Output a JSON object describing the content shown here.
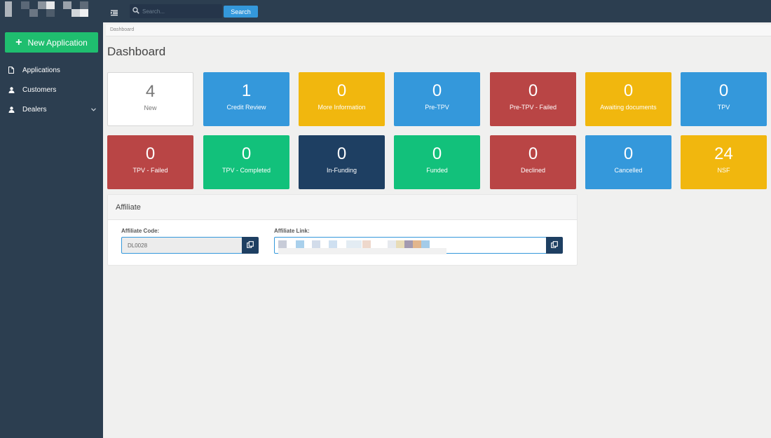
{
  "sidebar": {
    "new_application_label": "New Application",
    "items": [
      {
        "label": "Applications",
        "icon": "file-icon"
      },
      {
        "label": "Customers",
        "icon": "user-icon"
      },
      {
        "label": "Dealers",
        "icon": "user-icon",
        "has_submenu": true
      }
    ]
  },
  "topbar": {
    "search_placeholder": "Search...",
    "search_button_label": "Search"
  },
  "breadcrumb": "Dashboard",
  "page_title": "Dashboard",
  "tiles": [
    {
      "count": "4",
      "label": "New",
      "color": "#ffffff"
    },
    {
      "count": "1",
      "label": "Credit Review",
      "color": "#3498db"
    },
    {
      "count": "0",
      "label": "More Information",
      "color": "#f1b70e"
    },
    {
      "count": "0",
      "label": "Pre-TPV",
      "color": "#3498db"
    },
    {
      "count": "0",
      "label": "Pre-TPV - Failed",
      "color": "#b94545"
    },
    {
      "count": "0",
      "label": "Awaiting documents",
      "color": "#f1b70e"
    },
    {
      "count": "0",
      "label": "TPV",
      "color": "#3498db"
    },
    {
      "count": "0",
      "label": "TPV - Failed",
      "color": "#b94545"
    },
    {
      "count": "0",
      "label": "TPV - Completed",
      "color": "#12c17b"
    },
    {
      "count": "0",
      "label": "In-Funding",
      "color": "#1e3f62"
    },
    {
      "count": "0",
      "label": "Funded",
      "color": "#12c17b"
    },
    {
      "count": "0",
      "label": "Declined",
      "color": "#b94545"
    },
    {
      "count": "0",
      "label": "Cancelled",
      "color": "#3498db"
    },
    {
      "count": "24",
      "label": "NSF",
      "color": "#f1b70e"
    }
  ],
  "affiliate": {
    "title": "Affiliate",
    "code_label": "Affiliate Code:",
    "code_value": "DL0028",
    "link_label": "Affiliate Link:"
  }
}
